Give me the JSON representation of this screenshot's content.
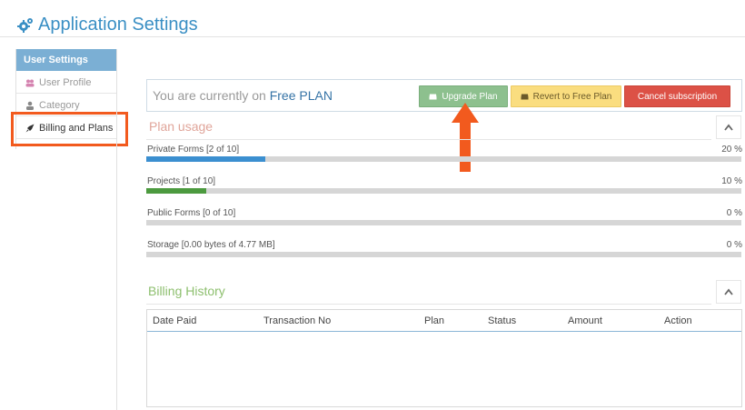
{
  "app": {
    "title": "Application Settings",
    "icon": "gears-icon",
    "accent": "#3a8fc4"
  },
  "sidebar": {
    "header": "User Settings",
    "items": [
      {
        "label": "User Profile",
        "icon": "users-icon"
      },
      {
        "label": "Category",
        "icon": "user-icon"
      },
      {
        "label": "Billing and Plans",
        "icon": "rocket-icon",
        "active": true
      }
    ]
  },
  "plan": {
    "prefix": "You are currently on",
    "name": "Free PLAN",
    "buttons": {
      "upgrade": "Upgrade Plan",
      "revert": "Revert to Free Plan",
      "cancel": "Cancel subscription"
    }
  },
  "usage": {
    "title": "Plan usage",
    "items": [
      {
        "label": "Private Forms [2 of 10]",
        "percent_text": "20 %",
        "percent": 20,
        "color": "#3b8fd0"
      },
      {
        "label": "Projects [1 of 10]",
        "percent_text": "10 %",
        "percent": 10,
        "color": "#4c9a3f"
      },
      {
        "label": "Public Forms [0 of 10]",
        "percent_text": "0 %",
        "percent": 0,
        "color": "#3b8fd0"
      },
      {
        "label": "Storage [0.00 bytes of 4.77 MB]",
        "percent_text": "0 %",
        "percent": 0,
        "color": "#3b8fd0"
      }
    ]
  },
  "billing": {
    "title": "Billing History",
    "columns": [
      "Date Paid",
      "Transaction No",
      "Plan",
      "Status",
      "Amount",
      "Action"
    ]
  }
}
